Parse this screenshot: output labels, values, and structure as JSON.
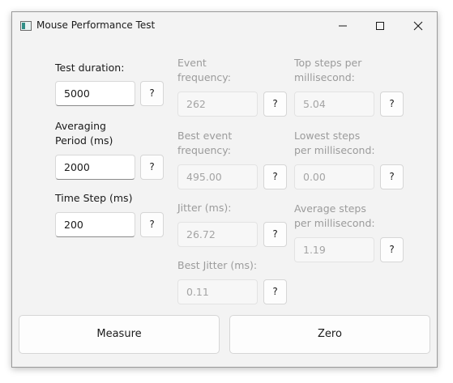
{
  "window": {
    "title": "Mouse Performance Test"
  },
  "inputs": {
    "test_duration": {
      "label": "Test duration:",
      "value": "5000",
      "help": "?"
    },
    "averaging_period": {
      "label_line1": "Averaging",
      "label_line2": "Period (ms)",
      "value": "2000",
      "help": "?"
    },
    "time_step": {
      "label": "Time Step (ms)",
      "value": "200",
      "help": "?"
    }
  },
  "stats_middle": {
    "event_frequency": {
      "label_line1": "Event",
      "label_line2": "frequency:",
      "value": "262",
      "help": "?"
    },
    "best_event_frequency": {
      "label_line1": "Best event",
      "label_line2": "frequency:",
      "value": "495.00",
      "help": "?"
    },
    "jitter": {
      "label": "Jitter (ms):",
      "value": "26.72",
      "help": "?"
    },
    "best_jitter": {
      "label": "Best Jitter (ms):",
      "value": "0.11",
      "help": "?"
    }
  },
  "stats_right": {
    "top_steps": {
      "label_line1": "Top steps per",
      "label_line2": "millisecond:",
      "value": "5.04",
      "help": "?"
    },
    "lowest_steps": {
      "label_line1": "Lowest steps",
      "label_line2": "per millisecond:",
      "value": "0.00",
      "help": "?"
    },
    "average_steps": {
      "label_line1": "Average steps",
      "label_line2": "per millisecond:",
      "value": "1.19",
      "help": "?"
    }
  },
  "buttons": {
    "measure": "Measure",
    "zero": "Zero"
  }
}
